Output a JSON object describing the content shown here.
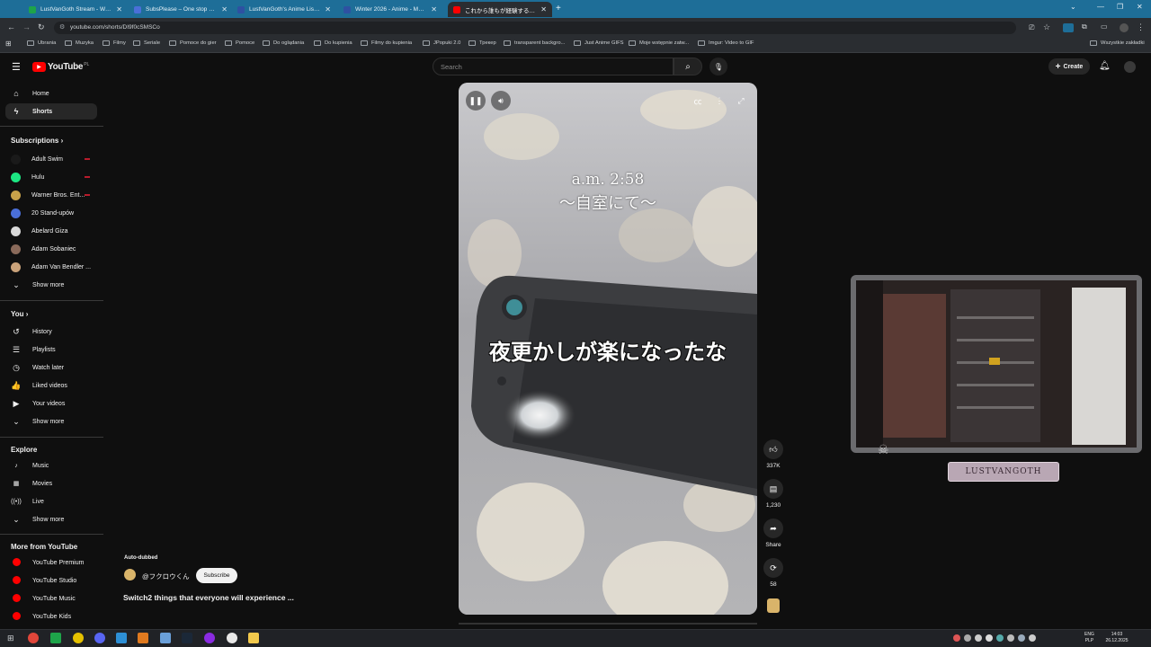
{
  "browser": {
    "tabs": [
      {
        "title": "LustVanGoth Stream - Watch L",
        "color": "#1ea44a"
      },
      {
        "title": "SubsPlease – One stop shop fo",
        "color": "#4a6fd8"
      },
      {
        "title": "LustVanGoth's Anime List - My",
        "color": "#2e51a2"
      },
      {
        "title": "Winter 2026 - Anime - MyAnim",
        "color": "#2e51a2"
      },
      {
        "title": "これから誰もが経験するであろ",
        "color": "#ff0000"
      }
    ],
    "new_tab": "+",
    "url": "youtube.com/shorts/DI9f0cSMSCo",
    "bookmarks": [
      "Ubrania",
      "Muzyka",
      "Filmy",
      "Seriale",
      "Pomoce do gier",
      "Pomoce",
      "Do oglądania",
      "Do kupienia",
      "Filmy do kupienia",
      "JPopuki 2.0",
      "Трекер",
      "transparent backgro...",
      "Just Anime GIFS",
      "Moje wstępnie zatw...",
      "Imgur: Video to GIF"
    ],
    "all_bookmarks": "Wszystkie zakładki"
  },
  "header": {
    "logo": "YouTube",
    "region": "PL",
    "search_placeholder": "Search",
    "create_label": "Create"
  },
  "sidebar": {
    "main": [
      {
        "label": "Home",
        "icon": "home-icon",
        "glyph": "⌂"
      },
      {
        "label": "Shorts",
        "icon": "shorts-icon",
        "glyph": "ϟ"
      }
    ],
    "subscriptions_title": "Subscriptions",
    "subscriptions": [
      {
        "label": "Adult Swim",
        "color": "#1a1a1a",
        "live": true
      },
      {
        "label": "Hulu",
        "color": "#1ce783",
        "live": true
      },
      {
        "label": "Warner Bros. Ent...",
        "color": "#c8a24a",
        "live": true
      },
      {
        "label": "20 Stand-upów",
        "color": "#4a6fd8",
        "live": false
      },
      {
        "label": "Abelard Giza",
        "color": "#d9d9d9",
        "live": false
      },
      {
        "label": "Adam Sobaniec",
        "color": "#8a6a5a",
        "live": false
      },
      {
        "label": "Adam Van Bendler ...",
        "color": "#c9a27a",
        "live": false
      }
    ],
    "show_more": "Show more",
    "you_title": "You",
    "you": [
      {
        "label": "History",
        "icon": "history-icon",
        "glyph": "↺"
      },
      {
        "label": "Playlists",
        "icon": "playlists-icon",
        "glyph": "☰"
      },
      {
        "label": "Watch later",
        "icon": "watch-later-icon",
        "glyph": "◷"
      },
      {
        "label": "Liked videos",
        "icon": "like-icon",
        "glyph": "👍"
      },
      {
        "label": "Your videos",
        "icon": "your-videos-icon",
        "glyph": "▶"
      }
    ],
    "explore_title": "Explore",
    "explore": [
      {
        "label": "Music",
        "icon": "music-icon",
        "glyph": "♪"
      },
      {
        "label": "Movies",
        "icon": "movies-icon",
        "glyph": "▦"
      },
      {
        "label": "Live",
        "icon": "live-icon",
        "glyph": "((•))"
      }
    ],
    "more_title": "More from YouTube",
    "more": [
      "YouTube Premium",
      "YouTube Studio",
      "YouTube Music",
      "YouTube Kids"
    ]
  },
  "short": {
    "auto_dubbed": "Auto-dubbed",
    "channel": "@フクロウくん",
    "subscribe": "Subscribe",
    "title": "Switch2 things that everyone will experience ...",
    "overlay_time": "a.m. 2:58",
    "overlay_place": "〜自室にて〜",
    "overlay_caption": "夜更かしが楽になったな",
    "likes": "337K",
    "comments": "1,230",
    "share": "Share",
    "remix": "58"
  },
  "overlay_cam": {
    "label": "LUSTVANGOTH"
  },
  "system": {
    "lang": "ENG",
    "layout": "PLP",
    "time": "14:03",
    "date": "26.12.2025"
  },
  "colors": {
    "brand_red": "#ff0000",
    "tab_bar": "#1e6e98"
  }
}
